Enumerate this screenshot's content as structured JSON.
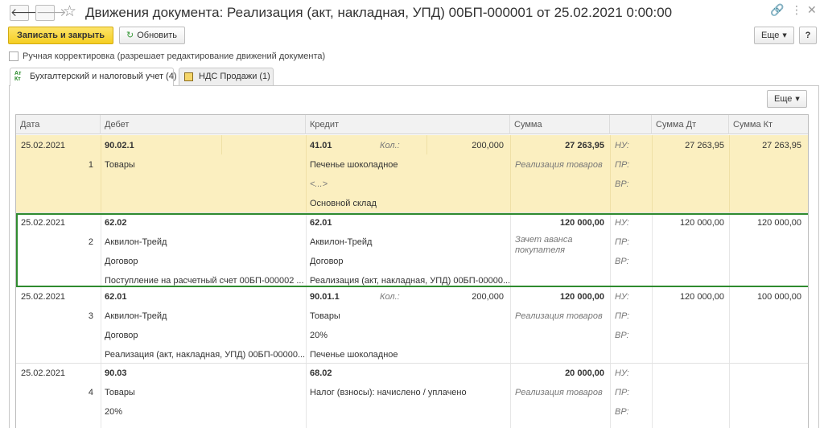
{
  "window": {
    "title": "Движения документа: Реализация (акт, накладная, УПД) 00БП-000001 от 25.02.2021 0:00:00",
    "back_icon": "🡐",
    "forward_icon": "🡒",
    "star_icon": "☆",
    "link_icon": "🔗",
    "menu_icon": "⋮",
    "close_icon": "✕"
  },
  "toolbar": {
    "save_close_label": "Записать и закрыть",
    "refresh_label": "Обновить",
    "refresh_icon": "↻",
    "more_label": "Еще",
    "help_label": "?"
  },
  "manual_adjust": {
    "checked": false,
    "label": "Ручная корректировка (разрешает редактирование движений документа)"
  },
  "tabs": [
    {
      "label": "Бухгалтерский и налоговый учет (4)",
      "icon_text": "Ат Кт",
      "active": true
    },
    {
      "label": "НДС Продажи (1)",
      "active": false
    }
  ],
  "table_toolbar": {
    "more_label": "Еще"
  },
  "columns": {
    "date": "Дата",
    "debit": "Дебет",
    "credit": "Кредит",
    "sum": "Сумма",
    "sum_dt": "Сумма Дт",
    "sum_kt": "Сумма Кт"
  },
  "records": [
    {
      "date": "25.02.2021",
      "num": "1",
      "debit_account": "90.02.1",
      "debit_lines": [
        "Товары",
        "",
        ""
      ],
      "credit_account": "41.01",
      "credit_qty_label": "Кол.:",
      "credit_qty": "200,000",
      "credit_lines": [
        "Печенье шоколадное",
        "<...>",
        "Основной склад"
      ],
      "sum": "27 263,95",
      "content": "Реализация товаров",
      "nu_label": "НУ:",
      "pr_label": "ПР:",
      "vr_label": "ВР:",
      "sum_dt": "27 263,95",
      "sum_kt": "27 263,95",
      "highlight": "yellow"
    },
    {
      "date": "25.02.2021",
      "num": "2",
      "debit_account": "62.02",
      "debit_lines": [
        "Аквилон-Трейд",
        "Договор",
        "Поступление на расчетный счет 00БП-000002 ..."
      ],
      "credit_account": "62.01",
      "credit_qty_label": "",
      "credit_qty": "",
      "credit_lines": [
        "Аквилон-Трейд",
        "Договор",
        "Реализация (акт, накладная, УПД) 00БП-00000..."
      ],
      "sum": "120 000,00",
      "content": "Зачет аванса покупателя",
      "nu_label": "НУ:",
      "pr_label": "ПР:",
      "vr_label": "ВР:",
      "sum_dt": "120 000,00",
      "sum_kt": "120 000,00",
      "highlight": "selected"
    },
    {
      "date": "25.02.2021",
      "num": "3",
      "debit_account": "62.01",
      "debit_lines": [
        "Аквилон-Трейд",
        "Договор",
        "Реализация (акт, накладная, УПД) 00БП-00000..."
      ],
      "credit_account": "90.01.1",
      "credit_qty_label": "Кол.:",
      "credit_qty": "200,000",
      "credit_lines": [
        "Товары",
        "20%",
        "Печенье шоколадное"
      ],
      "sum": "120 000,00",
      "content": "Реализация товаров",
      "nu_label": "НУ:",
      "pr_label": "ПР:",
      "vr_label": "ВР:",
      "sum_dt": "120 000,00",
      "sum_kt": "100 000,00",
      "highlight": "none"
    },
    {
      "date": "25.02.2021",
      "num": "4",
      "debit_account": "90.03",
      "debit_lines": [
        "Товары",
        "20%",
        ""
      ],
      "credit_account": "68.02",
      "credit_qty_label": "",
      "credit_qty": "",
      "credit_lines": [
        "Налог (взносы): начислено / уплачено",
        "",
        ""
      ],
      "sum": "20 000,00",
      "content": "Реализация товаров",
      "nu_label": "НУ:",
      "pr_label": "ПР:",
      "vr_label": "ВР:",
      "sum_dt": "",
      "sum_kt": "",
      "highlight": "none"
    }
  ]
}
